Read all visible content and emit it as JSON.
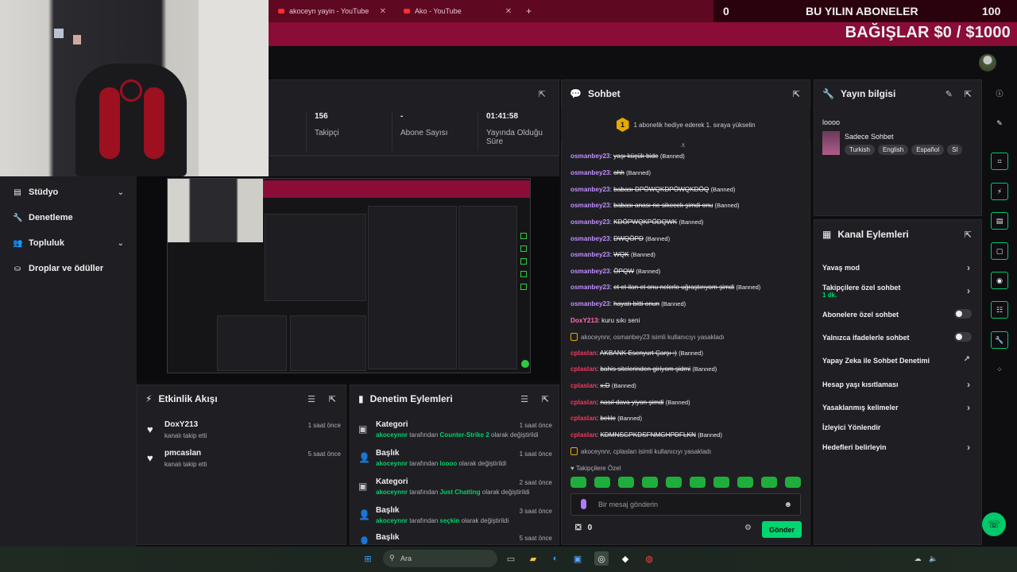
{
  "browser": {
    "tabs": [
      {
        "label": "akoceyn yayin - YouTube"
      },
      {
        "label": "Ako - YouTube"
      }
    ]
  },
  "goal": {
    "current": "0",
    "title": "BU YILIN ABONELER",
    "target": "100",
    "donation": "BAĞIŞLAR $0 / $1000"
  },
  "sidebar": {
    "items": [
      {
        "label": "Stüdyo"
      },
      {
        "label": "Denetleme"
      },
      {
        "label": "Topluluk"
      },
      {
        "label": "Droplar ve ödüller"
      }
    ]
  },
  "stats": [
    {
      "value": "156",
      "label": "Takipçi"
    },
    {
      "value": "-",
      "label": "Abone Sayısı"
    },
    {
      "value": "01:41:58",
      "label": "Yayında Olduğu Süre"
    }
  ],
  "activity": {
    "title": "Etkinlik Akışı",
    "items": [
      {
        "name": "DoxY213",
        "sub": "kanalı takip etti",
        "time": "1 saat önce"
      },
      {
        "name": "pmcaslan",
        "sub": "kanalı takip etti",
        "time": "5 saat önce"
      }
    ]
  },
  "modlog": {
    "title": "Denetim Eylemleri",
    "items": [
      {
        "head": "Kategori",
        "user": "akoceynnr",
        "mid": "tarafından",
        "value": "Counter-Strike 2",
        "tail": "olarak değiştirildi",
        "time": "1 saat önce"
      },
      {
        "head": "Başlık",
        "user": "akoceynnr",
        "mid": "tarafından",
        "value": "loooo",
        "tail": "olarak değiştirildi",
        "time": "1 saat önce"
      },
      {
        "head": "Kategori",
        "user": "akoceynnr",
        "mid": "tarafından",
        "value": "Just Chatting",
        "tail": "olarak değiştirildi",
        "time": "2 saat önce"
      },
      {
        "head": "Başlık",
        "user": "akoceynnr",
        "mid": "tarafından",
        "value": "seçkin",
        "tail": "olarak değiştirildi",
        "time": "3 saat önce"
      },
      {
        "head": "Başlık",
        "user": "",
        "mid": "",
        "value": "",
        "tail": "",
        "time": "5 saat önce"
      }
    ]
  },
  "chat": {
    "title": "Sohbet",
    "pin_badge": "1",
    "pin_text": "1 abonelik hediye ederek 1. sıraya yükselin",
    "messages": [
      {
        "user": "osmanbey23",
        "text": "yaşı küçük bide",
        "banned": "(Banned)",
        "color": "purple"
      },
      {
        "user": "osmanbey23",
        "text": "ohh",
        "banned": "(Banned)",
        "color": "purple"
      },
      {
        "user": "osmanbey23",
        "text": "babası DPÖWQKDPÖWQKDÖQ",
        "banned": "(Banned)",
        "color": "purple"
      },
      {
        "user": "osmanbey23",
        "text": "babası anası ne sikecek şimdi onu",
        "banned": "(Banned)",
        "color": "purple"
      },
      {
        "user": "osmanbey23",
        "text": "KDÖPWQKPÖDQWK",
        "banned": "(Banned)",
        "color": "purple"
      },
      {
        "user": "osmanbey23",
        "text": "DWQÖPD",
        "banned": "(Banned)",
        "color": "purple"
      },
      {
        "user": "osmanbey23",
        "text": "WQK",
        "banned": "(Banned)",
        "color": "purple"
      },
      {
        "user": "osmanbey23",
        "text": "ÖPQW",
        "banned": "(Banned)",
        "color": "purple"
      },
      {
        "user": "osmanbey23",
        "text": "et et ilan et onu nelerle uğraştırıyom şimdi",
        "banned": "(Banned)",
        "color": "purple"
      },
      {
        "user": "osmanbey23",
        "text": "hayatı bitti onun",
        "banned": "(Banned)",
        "color": "purple"
      },
      {
        "user": "DoxY213",
        "text": "kuru sıkı seni",
        "banned": "",
        "color": "pink"
      }
    ],
    "sys1": "akoceynnr, osmanbey23 isimli kullanıcıyı yasakladı",
    "messages2": [
      {
        "user": "cplaslan",
        "text": "AKBANK Esenyurt Çarşı :)",
        "banned": "(Banned)"
      },
      {
        "user": "cplaslan",
        "text": "bahis sitelerinden giriyom şidmi",
        "banned": "(Banned)"
      },
      {
        "user": "cplaslan",
        "text": "x:D",
        "banned": "(Banned)"
      },
      {
        "user": "cplaslan",
        "text": "nasıl dava yiyon şimdi",
        "banned": "(Banned)"
      },
      {
        "user": "cplaslan",
        "text": "bekle",
        "banned": "(Banned)"
      },
      {
        "user": "cplaslan",
        "text": "KDMNSGPKDSFNMGHPDFLKN",
        "banned": "(Banned)"
      }
    ],
    "sys2": "akoceynnr, cplaslan isimli kullanıcıyı yasakladı",
    "followers_only": "Takipçilere Özel",
    "input_placeholder": "Bir mesaj gönderin",
    "points": "0",
    "send": "Gönder"
  },
  "streaminfo": {
    "title": "Yayın bilgisi",
    "stream_title": "loooo",
    "category": "Sadece Sohbet",
    "tags": [
      "Turkish",
      "English",
      "Español",
      "Sl"
    ]
  },
  "actions": {
    "title": "Kanal Eylemleri",
    "items": [
      {
        "label": "Yavaş mod",
        "kind": "chevron"
      },
      {
        "label": "Takipçilere özel sohbet",
        "sub": "1 dk.",
        "kind": "chevron"
      },
      {
        "label": "Abonelere özel sohbet",
        "kind": "toggle"
      },
      {
        "label": "Yalnızca ifadelerle sohbet",
        "kind": "toggle"
      },
      {
        "label": "Yapay Zeka ile Sohbet Denetimi",
        "kind": "external"
      },
      {
        "label": "Hesap yaşı kısıtlaması",
        "kind": "chevron"
      },
      {
        "label": "Yasaklanmış kelimeler",
        "kind": "chevron"
      },
      {
        "label": "İzleyici Yönlendir",
        "kind": "none"
      },
      {
        "label": "Hedefleri belirleyin",
        "kind": "chevron"
      }
    ]
  },
  "taskbar": {
    "search": "Ara"
  },
  "colors": {
    "brand": "#8a0c37",
    "accent": "#00d66f",
    "chat_user_purple": "#c38dff",
    "chat_user_red": "#f2395e"
  }
}
